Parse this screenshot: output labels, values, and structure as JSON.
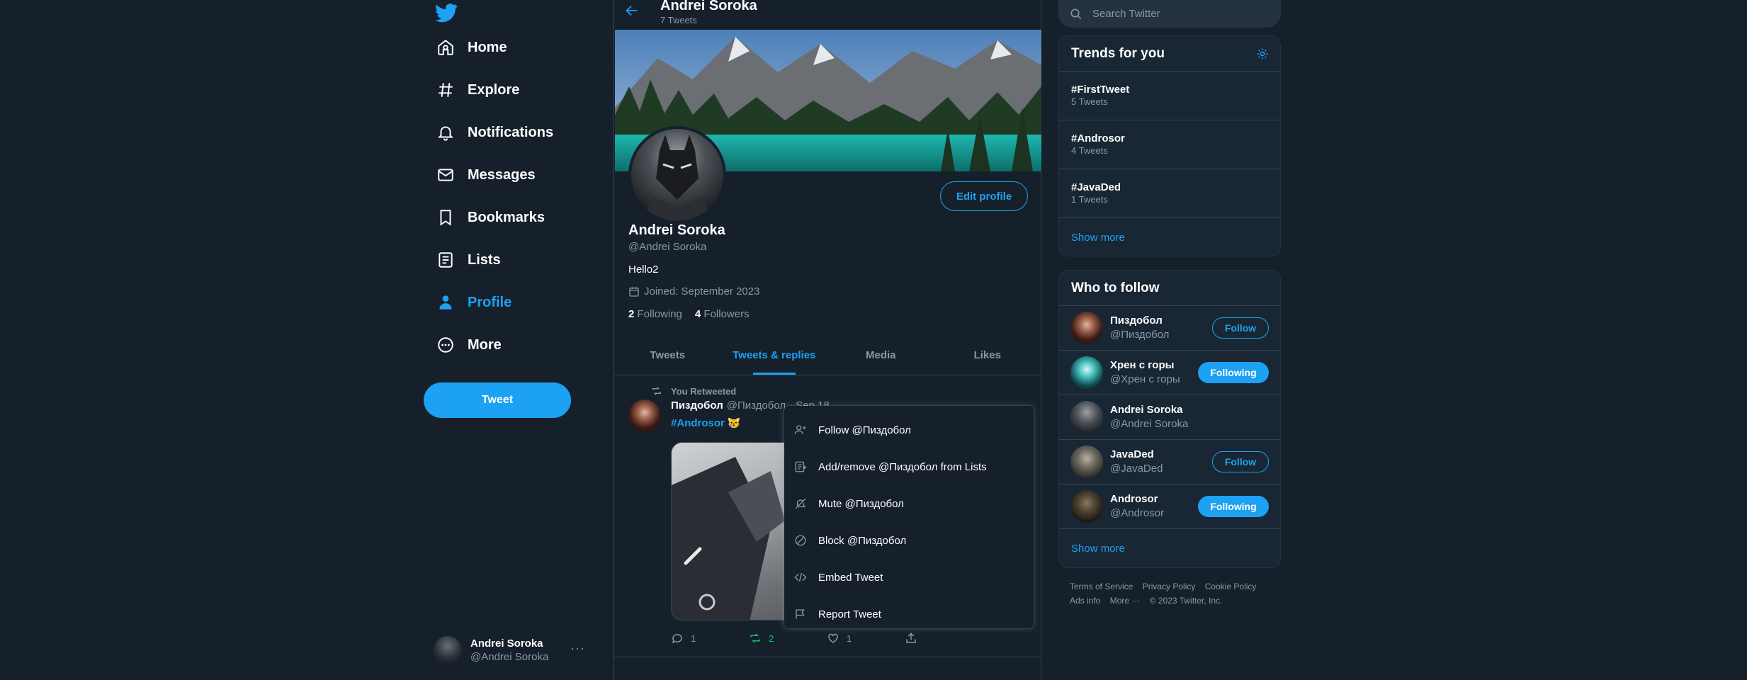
{
  "colors": {
    "accent": "#1da1f2",
    "background": "#15202b",
    "panel": "#192734",
    "muted": "#8899a6",
    "retweet": "#17bf63"
  },
  "nav": {
    "logo": "twitter-logo",
    "items": [
      {
        "label": "Home",
        "icon": "home-icon"
      },
      {
        "label": "Explore",
        "icon": "hashtag-icon"
      },
      {
        "label": "Notifications",
        "icon": "bell-icon"
      },
      {
        "label": "Messages",
        "icon": "mail-icon"
      },
      {
        "label": "Bookmarks",
        "icon": "bookmark-icon"
      },
      {
        "label": "Lists",
        "icon": "list-icon"
      },
      {
        "label": "Profile",
        "icon": "person-icon",
        "active": true
      },
      {
        "label": "More",
        "icon": "more-circle-icon"
      }
    ],
    "tweet_button": "Tweet",
    "account": {
      "name": "Andrei Soroka",
      "handle": "@Andrei Soroka",
      "more": "···"
    }
  },
  "header": {
    "title": "Andrei Soroka",
    "count": "7 Tweets"
  },
  "profile": {
    "edit_button": "Edit profile",
    "name": "Andrei Soroka",
    "handle": "@Andrei Soroka",
    "bio": "Hello2",
    "joined": "Joined: September 2023",
    "following_count": "2",
    "following_label": "Following",
    "followers_count": "4",
    "followers_label": "Followers"
  },
  "tabs": [
    {
      "label": "Tweets"
    },
    {
      "label": "Tweets & replies",
      "active": true
    },
    {
      "label": "Media"
    },
    {
      "label": "Likes"
    }
  ],
  "tweet": {
    "retweet_label": "You Retweeted",
    "author": "Пиздобол",
    "handle": "@Пиздобол",
    "date": "· Sep 18",
    "hashtag": "#Androsor",
    "emoji": "😿",
    "replies": "1",
    "retweets": "2",
    "likes": "1"
  },
  "menu": [
    {
      "label": "Follow @Пиздобол",
      "icon": "add-user-icon"
    },
    {
      "label": "Add/remove @Пиздобол from Lists",
      "icon": "list-add-icon"
    },
    {
      "label": "Mute @Пиздобол",
      "icon": "mute-icon"
    },
    {
      "label": "Block @Пиздобол",
      "icon": "block-icon"
    },
    {
      "label": "Embed Tweet",
      "icon": "code-icon"
    },
    {
      "label": "Report Tweet",
      "icon": "flag-icon"
    }
  ],
  "search": {
    "placeholder": "Search Twitter"
  },
  "trends": {
    "title": "Trends for you",
    "items": [
      {
        "name": "#FirstTweet",
        "count": "5 Tweets"
      },
      {
        "name": "#Androsor",
        "count": "4 Tweets"
      },
      {
        "name": "#JavaDed",
        "count": "1 Tweets"
      }
    ],
    "show_more": "Show more"
  },
  "who_to_follow": {
    "title": "Who to follow",
    "items": [
      {
        "name": "Пиздобол",
        "handle": "@Пиздобол",
        "button": "Follow",
        "state": "follow"
      },
      {
        "name": "Хрен с горы",
        "handle": "@Хрен с горы",
        "button": "Following",
        "state": "following"
      },
      {
        "name": "Andrei Soroka",
        "handle": "@Andrei Soroka",
        "button": "",
        "state": "self"
      },
      {
        "name": "JavaDed",
        "handle": "@JavaDed",
        "button": "Follow",
        "state": "follow"
      },
      {
        "name": "Androsor",
        "handle": "@Androsor",
        "button": "Following",
        "state": "following"
      }
    ],
    "show_more": "Show more"
  },
  "footer": {
    "terms": "Terms of Service",
    "privacy": "Privacy Policy",
    "cookie": "Cookie Policy",
    "ads": "Ads info",
    "more": "More ···",
    "copyright": "© 2023 Twitter, Inc."
  }
}
